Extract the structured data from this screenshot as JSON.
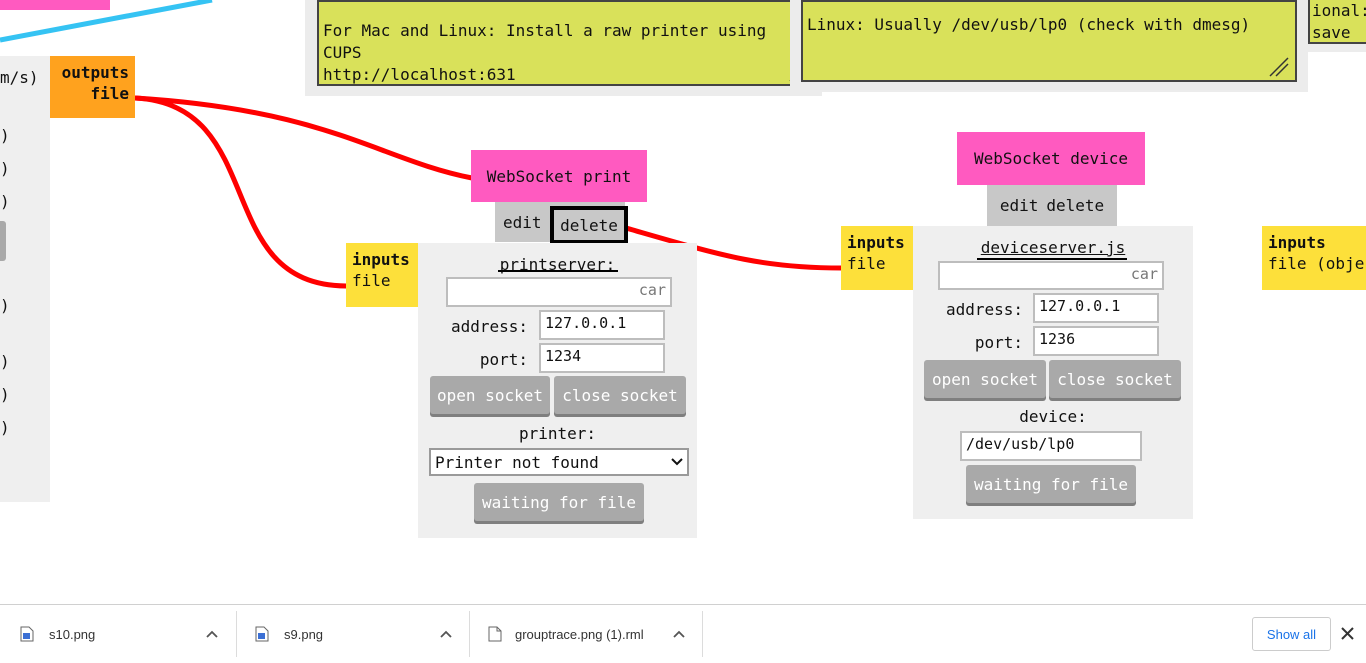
{
  "notes": {
    "cups": "For Mac and Linux: Install a raw printer using\nCUPS\nhttp://localhost:631",
    "linux": "Linux: Usually /dev/usb/lp0 (check with dmesg)",
    "right_partial_line1": "ional:",
    "right_partial_line2": "save t"
  },
  "left_panel": {
    "partial_rows": [
      "m/s)",
      ")",
      ")",
      ")",
      ")",
      ")",
      ")",
      ")"
    ]
  },
  "outputs_node": {
    "label_line1": "outputs",
    "label_line2": "file"
  },
  "print_node": {
    "title": "WebSocket print",
    "edit_label": "edit",
    "delete_label": "delete",
    "inputs_label": "inputs",
    "inputs_type": "file",
    "script_name": "printserver:",
    "empty_field_value": "car",
    "address_label": "address:",
    "address_value": "127.0.0.1",
    "port_label": "port:",
    "port_value": "1234",
    "open_socket_label": "open socket",
    "close_socket_label": "close socket",
    "printer_label": "printer:",
    "printer_selected": "Printer not found",
    "status_label": "waiting for file"
  },
  "device_node": {
    "title": "WebSocket device",
    "edit_label": "edit",
    "delete_label": "delete",
    "inputs_label": "inputs",
    "inputs_type": "file",
    "script_name": "deviceserver.js",
    "empty_field_value": "car",
    "address_label": "address:",
    "address_value": "127.0.0.1",
    "port_label": "port:",
    "port_value": "1236",
    "open_socket_label": "open socket",
    "close_socket_label": "close socket",
    "device_label": "device:",
    "device_value": "/dev/usb/lp0",
    "status_label": "waiting for file"
  },
  "right_partial_node": {
    "inputs_label": "inputs",
    "inputs_type": "file (obje"
  },
  "colors": {
    "wire": "#ff0000",
    "pink": "#ff5ac0",
    "yellow": "#fde03a",
    "orange": "#ffa21e",
    "note": "#d9e15a",
    "accent_line": "#35c3f3"
  },
  "downloads": {
    "items": [
      {
        "name": "s10.png",
        "icon": "image-file-icon"
      },
      {
        "name": "s9.png",
        "icon": "image-file-icon"
      },
      {
        "name": "grouptrace.png (1).rml",
        "icon": "document-file-icon"
      }
    ],
    "show_all_label": "Show all",
    "close_icon": "close-icon"
  }
}
